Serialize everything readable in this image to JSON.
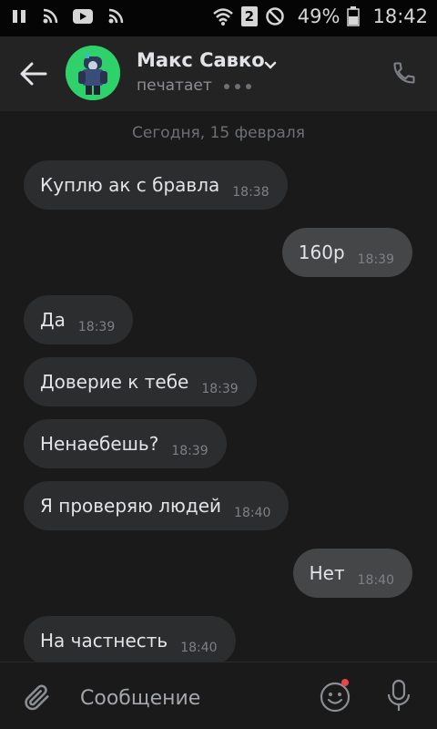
{
  "status_bar": {
    "sim_badge": "2",
    "battery": "49%",
    "time": "18:42"
  },
  "header": {
    "contact_name": "Макс Савко",
    "status": "печатает"
  },
  "chat": {
    "date_separator": "Сегодня, 15 февраля",
    "messages": [
      {
        "direction": "in",
        "text": "Куплю ак с бравла",
        "time": "18:38"
      },
      {
        "direction": "out",
        "text": "160р",
        "time": "18:39"
      },
      {
        "direction": "in",
        "text": "Да",
        "time": "18:39"
      },
      {
        "direction": "in",
        "text": "Доверие к тебе",
        "time": "18:39"
      },
      {
        "direction": "in",
        "text": "Ненаебешь?",
        "time": "18:39"
      },
      {
        "direction": "in",
        "text": "Я проверяю людей",
        "time": "18:40"
      },
      {
        "direction": "out",
        "text": "Нет",
        "time": "18:40"
      },
      {
        "direction": "in",
        "text": "На частнесть",
        "time": "18:40"
      }
    ]
  },
  "composer": {
    "placeholder": "Сообщение"
  },
  "icons": {
    "back": "arrow-left-icon",
    "call": "phone-icon",
    "attach": "paperclip-icon",
    "emoji": "smiley-icon",
    "mic": "microphone-icon"
  },
  "colors": {
    "background": "#1a1a1b",
    "header": "#232324",
    "incoming_bubble": "#2c2d2e",
    "outgoing_bubble": "#454647",
    "avatar_bg": "#2fd16a",
    "notification_dot": "#e64646"
  }
}
